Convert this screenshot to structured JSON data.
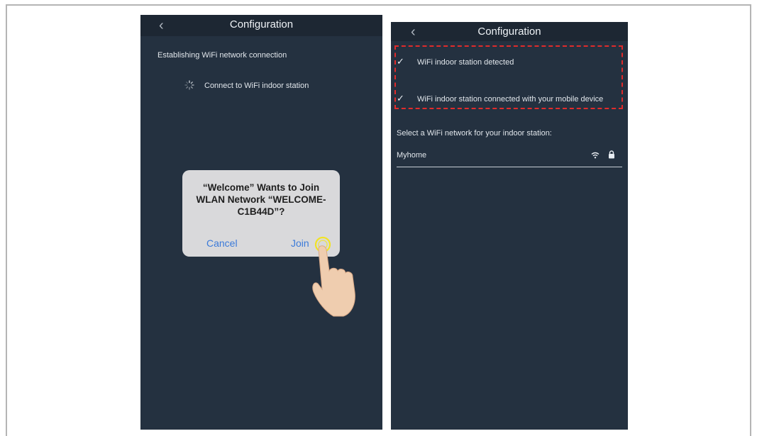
{
  "left_screen": {
    "nav": {
      "back": "‹",
      "title": "Configuration"
    },
    "status_text": "Establishing WiFi network connection",
    "step_text": "Connect to WiFi indoor station",
    "dialog": {
      "message": "“Welcome” Wants to Join\nWLAN Network “WELCOME-\nC1B44D”?",
      "cancel_label": "Cancel",
      "join_label": "Join"
    }
  },
  "right_screen": {
    "nav": {
      "back": "‹",
      "title": "Configuration"
    },
    "checks": [
      {
        "mark": "✓",
        "label": "WiFi indoor station detected"
      },
      {
        "mark": "✓",
        "label": "WiFi indoor station connected with your mobile device"
      }
    ],
    "select_prompt": "Select a WiFi network for your indoor station:",
    "network": {
      "name": "Myhome"
    }
  },
  "colors": {
    "screen_bg": "#243140",
    "navbar_bg": "#1d2733",
    "dialog_bg": "#d9d9db",
    "button_blue": "#3b7ad9",
    "highlight_red": "#e02b2b"
  }
}
